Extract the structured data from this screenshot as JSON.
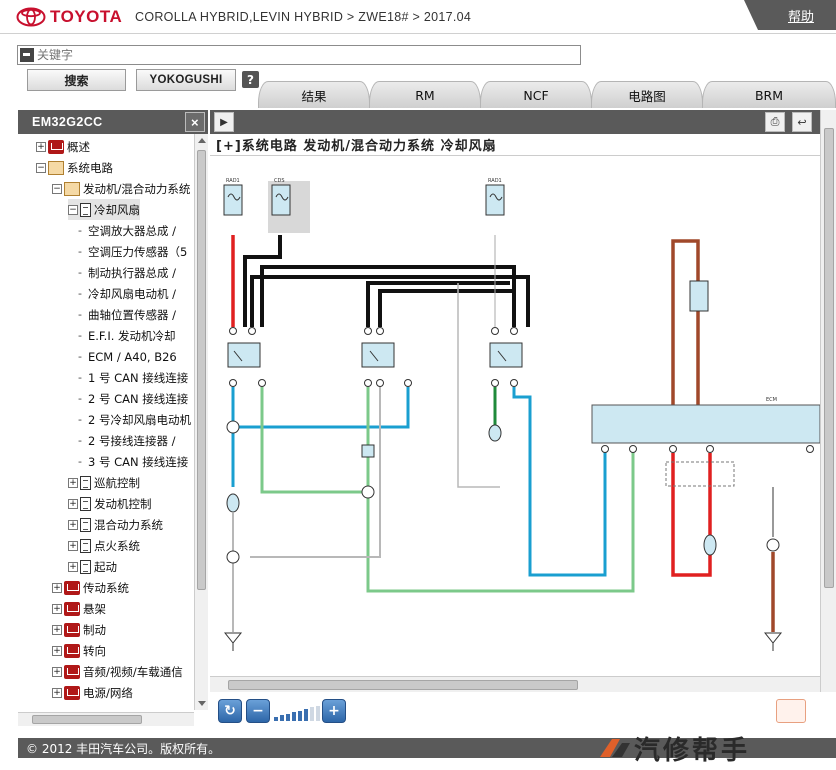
{
  "header": {
    "brand": "TOYOTA",
    "breadcrumb": "COROLLA HYBRID,LEVIN HYBRID > ZWE18# > 2017.04",
    "help_label": "帮助"
  },
  "search": {
    "placeholder": "关键字",
    "search_button": "搜索",
    "yokogushi_button": "YOKOGUSHI",
    "help_button": "?"
  },
  "tabs": [
    {
      "label": "结果"
    },
    {
      "label": "RM"
    },
    {
      "label": "NCF"
    },
    {
      "label": "电路图"
    },
    {
      "label": "BRM"
    }
  ],
  "left_panel": {
    "title": "EM32G2CC",
    "close": "×"
  },
  "tree": [
    {
      "label": "概述",
      "icon": "closed-book-icon",
      "toggle": "+"
    },
    {
      "label": "系统电路",
      "icon": "open-book-icon",
      "toggle": "−"
    },
    {
      "label": "发动机/混合动力系统",
      "icon": "open-book-icon",
      "toggle": "−"
    },
    {
      "label": "冷却风扇",
      "icon": "document-icon",
      "toggle": "−"
    },
    {
      "label": "空调放大器总成 /"
    },
    {
      "label": "空调压力传感器（5"
    },
    {
      "label": "制动执行器总成 /"
    },
    {
      "label": "冷却风扇电动机 /"
    },
    {
      "label": "曲轴位置传感器 /"
    },
    {
      "label": "E.F.I. 发动机冷却"
    },
    {
      "label": "ECM / A40, B26"
    },
    {
      "label": "1 号 CAN 接线连接"
    },
    {
      "label": "2 号 CAN 接线连接"
    },
    {
      "label": "2 号冷却风扇电动机"
    },
    {
      "label": "2 号接线连接器 /"
    },
    {
      "label": "3 号 CAN 接线连接"
    },
    {
      "label": "巡航控制",
      "icon": "document-icon",
      "toggle": "+"
    },
    {
      "label": "发动机控制",
      "icon": "document-icon",
      "toggle": "+"
    },
    {
      "label": "混合动力系统",
      "icon": "document-icon",
      "toggle": "+"
    },
    {
      "label": "点火系统",
      "icon": "document-icon",
      "toggle": "+"
    },
    {
      "label": "起动",
      "icon": "document-icon",
      "toggle": "+"
    },
    {
      "label": "传动系统",
      "icon": "closed-book-icon",
      "toggle": "+"
    },
    {
      "label": "悬架",
      "icon": "closed-book-icon",
      "toggle": "+"
    },
    {
      "label": "制动",
      "icon": "closed-book-icon",
      "toggle": "+"
    },
    {
      "label": "转向",
      "icon": "closed-book-icon",
      "toggle": "+"
    },
    {
      "label": "音频/视频/车载通信",
      "icon": "closed-book-icon",
      "toggle": "+"
    },
    {
      "label": "电源/网络",
      "icon": "closed-book-icon",
      "toggle": "+"
    }
  ],
  "diagram": {
    "title": "[+]系统电路  发动机/混合动力系统  冷却风扇",
    "fuse_labels": [
      "RAD1",
      "CDS",
      "RAD1"
    ],
    "ecm_label": "ECM",
    "wire_colors": {
      "red": "#e02020",
      "black": "#111111",
      "blue": "#1a9fd0",
      "green": "#7cc98a",
      "dark_green": "#1f8a3a",
      "brown": "#a0482a",
      "grey": "#b8b8b8"
    }
  },
  "zoom": {
    "level": 6,
    "steps": 8
  },
  "footer": {
    "copyright": "© 2012 丰田汽车公司。版权所有。"
  },
  "watermark": {
    "text": "汽修帮手"
  }
}
